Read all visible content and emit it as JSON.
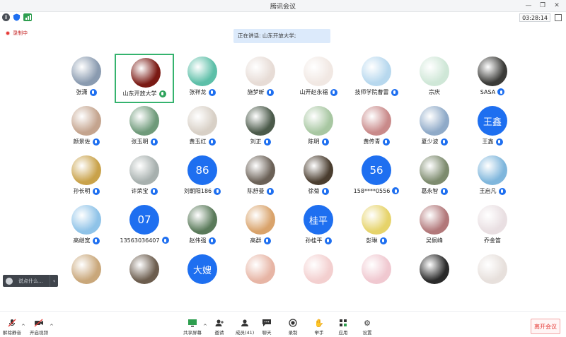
{
  "window": {
    "title": "腾讯会议"
  },
  "infobar": {
    "timer": "03:28:14"
  },
  "recording": {
    "label": "录制中"
  },
  "speaking": {
    "text": "正在讲话: 山东开放大学;"
  },
  "chat": {
    "placeholder": "说点什么..."
  },
  "participants": [
    {
      "name": "张潇",
      "avatar": "photo",
      "color": "#8a9bb0",
      "mic": "blue"
    },
    {
      "name": "山东开放大学",
      "avatar": "photo",
      "color": "#7a1a14",
      "mic": "green",
      "active": true
    },
    {
      "name": "张祥龙",
      "avatar": "photo",
      "color": "#5dbfa8",
      "mic": "blue"
    },
    {
      "name": "施梦昕",
      "avatar": "photo",
      "color": "#e7dcd6",
      "mic": "blue"
    },
    {
      "name": "山开赵永福",
      "avatar": "photo",
      "color": "#f1e8e3",
      "mic": "blue"
    },
    {
      "name": "技师学院曹雷",
      "avatar": "photo",
      "color": "#b7d8ee",
      "mic": "blue"
    },
    {
      "name": "宗庆",
      "avatar": "photo",
      "color": "#cfe7d7",
      "mic": "none"
    },
    {
      "name": "SASA",
      "avatar": "photo",
      "color": "#3b3b38",
      "mic": "blue"
    },
    {
      "name": "颜景佐",
      "avatar": "photo",
      "color": "#c4a48e",
      "mic": "blue"
    },
    {
      "name": "张玉明",
      "avatar": "photo",
      "color": "#6f9a7a",
      "mic": "blue"
    },
    {
      "name": "黄玉红",
      "avatar": "photo",
      "color": "#d8d0c6",
      "mic": "blue"
    },
    {
      "name": "刘正",
      "avatar": "photo",
      "color": "#4b5a4a",
      "mic": "blue"
    },
    {
      "name": "陈明",
      "avatar": "photo",
      "color": "#a8c7a2",
      "mic": "blue"
    },
    {
      "name": "黄传青",
      "avatar": "photo",
      "color": "#c98a8a",
      "mic": "blue"
    },
    {
      "name": "夏少波",
      "avatar": "photo",
      "color": "#8faac8",
      "mic": "blue"
    },
    {
      "name": "王鑫",
      "avatar": "text",
      "text": "王鑫",
      "color": "#1e6ff0",
      "mic": "blue"
    },
    {
      "name": "孙长明",
      "avatar": "photo",
      "color": "#c9a24a",
      "mic": "blue"
    },
    {
      "name": "许荣宝",
      "avatar": "photo",
      "color": "#a7b0ae",
      "mic": "blue"
    },
    {
      "name": "刘朝阳186",
      "avatar": "text",
      "text": "86",
      "color": "#1e6ff0",
      "mic": "blue"
    },
    {
      "name": "陈舒曼",
      "avatar": "photo",
      "color": "#6b6157",
      "mic": "blue"
    },
    {
      "name": "徐菊",
      "avatar": "photo",
      "color": "#4a3d2f",
      "mic": "blue"
    },
    {
      "name": "158****0556",
      "avatar": "text",
      "text": "56",
      "color": "#1e6ff0",
      "mic": "blue"
    },
    {
      "name": "葛永智",
      "avatar": "photo",
      "color": "#7d8b6e",
      "mic": "blue"
    },
    {
      "name": "王启凡",
      "avatar": "photo",
      "color": "#7fb6dc",
      "mic": "blue"
    },
    {
      "name": "高继宽",
      "avatar": "photo",
      "color": "#8fc3e8",
      "mic": "blue"
    },
    {
      "name": "13563036407",
      "avatar": "text",
      "text": "07",
      "color": "#1e6ff0",
      "mic": "blue"
    },
    {
      "name": "赵伟强",
      "avatar": "photo",
      "color": "#5a7a5a",
      "mic": "blue"
    },
    {
      "name": "高群",
      "avatar": "photo",
      "color": "#d9a36b",
      "mic": "blue"
    },
    {
      "name": "孙桂平",
      "avatar": "text",
      "text": "桂平",
      "color": "#1e6ff0",
      "mic": "blue"
    },
    {
      "name": "彭琳",
      "avatar": "photo",
      "color": "#e6d36a",
      "mic": "blue"
    },
    {
      "name": "吴佩峰",
      "avatar": "photo",
      "color": "#b2787a",
      "mic": "none"
    },
    {
      "name": "乔金笛",
      "avatar": "photo",
      "color": "#e9dfe2",
      "mic": "none"
    },
    {
      "name": "",
      "avatar": "photo",
      "color": "#c9a77a",
      "mic": "none"
    },
    {
      "name": "",
      "avatar": "photo",
      "color": "#6c5d4e",
      "mic": "none"
    },
    {
      "name": "",
      "avatar": "text",
      "text": "大嫂",
      "color": "#1e6ff0",
      "mic": "none"
    },
    {
      "name": "",
      "avatar": "photo",
      "color": "#e7b5a5",
      "mic": "none"
    },
    {
      "name": "",
      "avatar": "photo",
      "color": "#f3cfcf",
      "mic": "none"
    },
    {
      "name": "",
      "avatar": "photo",
      "color": "#f0c8d0",
      "mic": "none"
    },
    {
      "name": "",
      "avatar": "photo",
      "color": "#2a2a2a",
      "mic": "none"
    },
    {
      "name": "",
      "avatar": "photo",
      "color": "#e7e0dc",
      "mic": "none"
    }
  ],
  "toolbar": {
    "unmute": "解除静音",
    "video": "开启视频",
    "share": "共享屏幕",
    "invite": "邀请",
    "members": "成员(41)",
    "chat": "聊天",
    "record": "录制",
    "raise": "举手",
    "apps": "应用",
    "settings": "设置",
    "leave": "离开会议"
  },
  "colors": {
    "accent": "#1e6ff0",
    "leave": "#e53935",
    "active_border": "#35b36e"
  }
}
